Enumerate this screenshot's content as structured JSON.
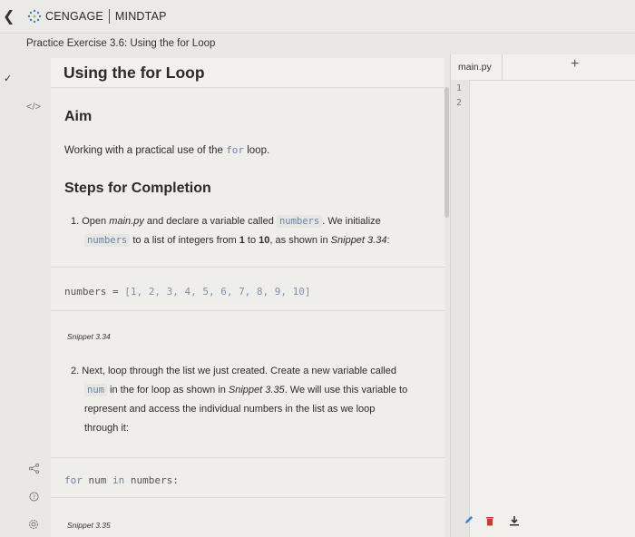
{
  "app": {
    "brand_primary": "CENGAGE",
    "brand_secondary": "MINDTAP",
    "breadcrumb": "Practice Exercise 3.6: Using the for Loop"
  },
  "nav": {
    "back_icon": "chevron-left-icon",
    "check_icon": "checkmark-icon"
  },
  "rail": {
    "items": [
      "book-icon",
      "code-icon",
      "share-icon",
      "help-icon",
      "settings-icon"
    ],
    "code_label": "</>"
  },
  "content": {
    "title": "Using the for Loop",
    "aim_heading": "Aim",
    "intro_before": "Working with a practical use of the",
    "intro_code": "for",
    "intro_after": "loop.",
    "steps_heading": "Steps for Completion",
    "step1": {
      "num": "1.",
      "t1": "Open",
      "file": "main.py",
      "t2": "and declare a variable called",
      "var": "numbers",
      "t3": ". We initialize",
      "var2": "numbers",
      "t4": "to a list of integers from",
      "b1": "1",
      "t5": "to",
      "b2": "10",
      "t6": ", as shown in",
      "snip": "Snippet 3.34",
      "t7": ":"
    },
    "code1": {
      "name": "numbers",
      "op": " = ",
      "values": "[1, 2, 3, 4, 5, 6, 7, 8, 9, 10]"
    },
    "caption1": "Snippet 3.34",
    "step2": {
      "num": "2.",
      "t1": "Next, loop through the list we just created. Create a new variable called",
      "var": "num",
      "t2": "in the for loop as shown in",
      "snip": "Snippet 3.35",
      "t3": ". We will use this variable to",
      "line3": "represent and access the individual numbers in the list as we loop",
      "line4": "through it:"
    },
    "code2": {
      "kw1": "for",
      "v1": " num ",
      "kw2": "in",
      "v2": " numbers:"
    },
    "caption2": "Snippet 3.35"
  },
  "editor": {
    "tab": "main.py",
    "add_symbol": "+",
    "lines": [
      "1",
      "2"
    ],
    "toolbar": [
      "pencil-icon",
      "trash-icon",
      "download-icon"
    ]
  },
  "colors": {
    "accent_code": "#6b84a8",
    "trash": "#d9342b",
    "pencil": "#3a86d4"
  }
}
